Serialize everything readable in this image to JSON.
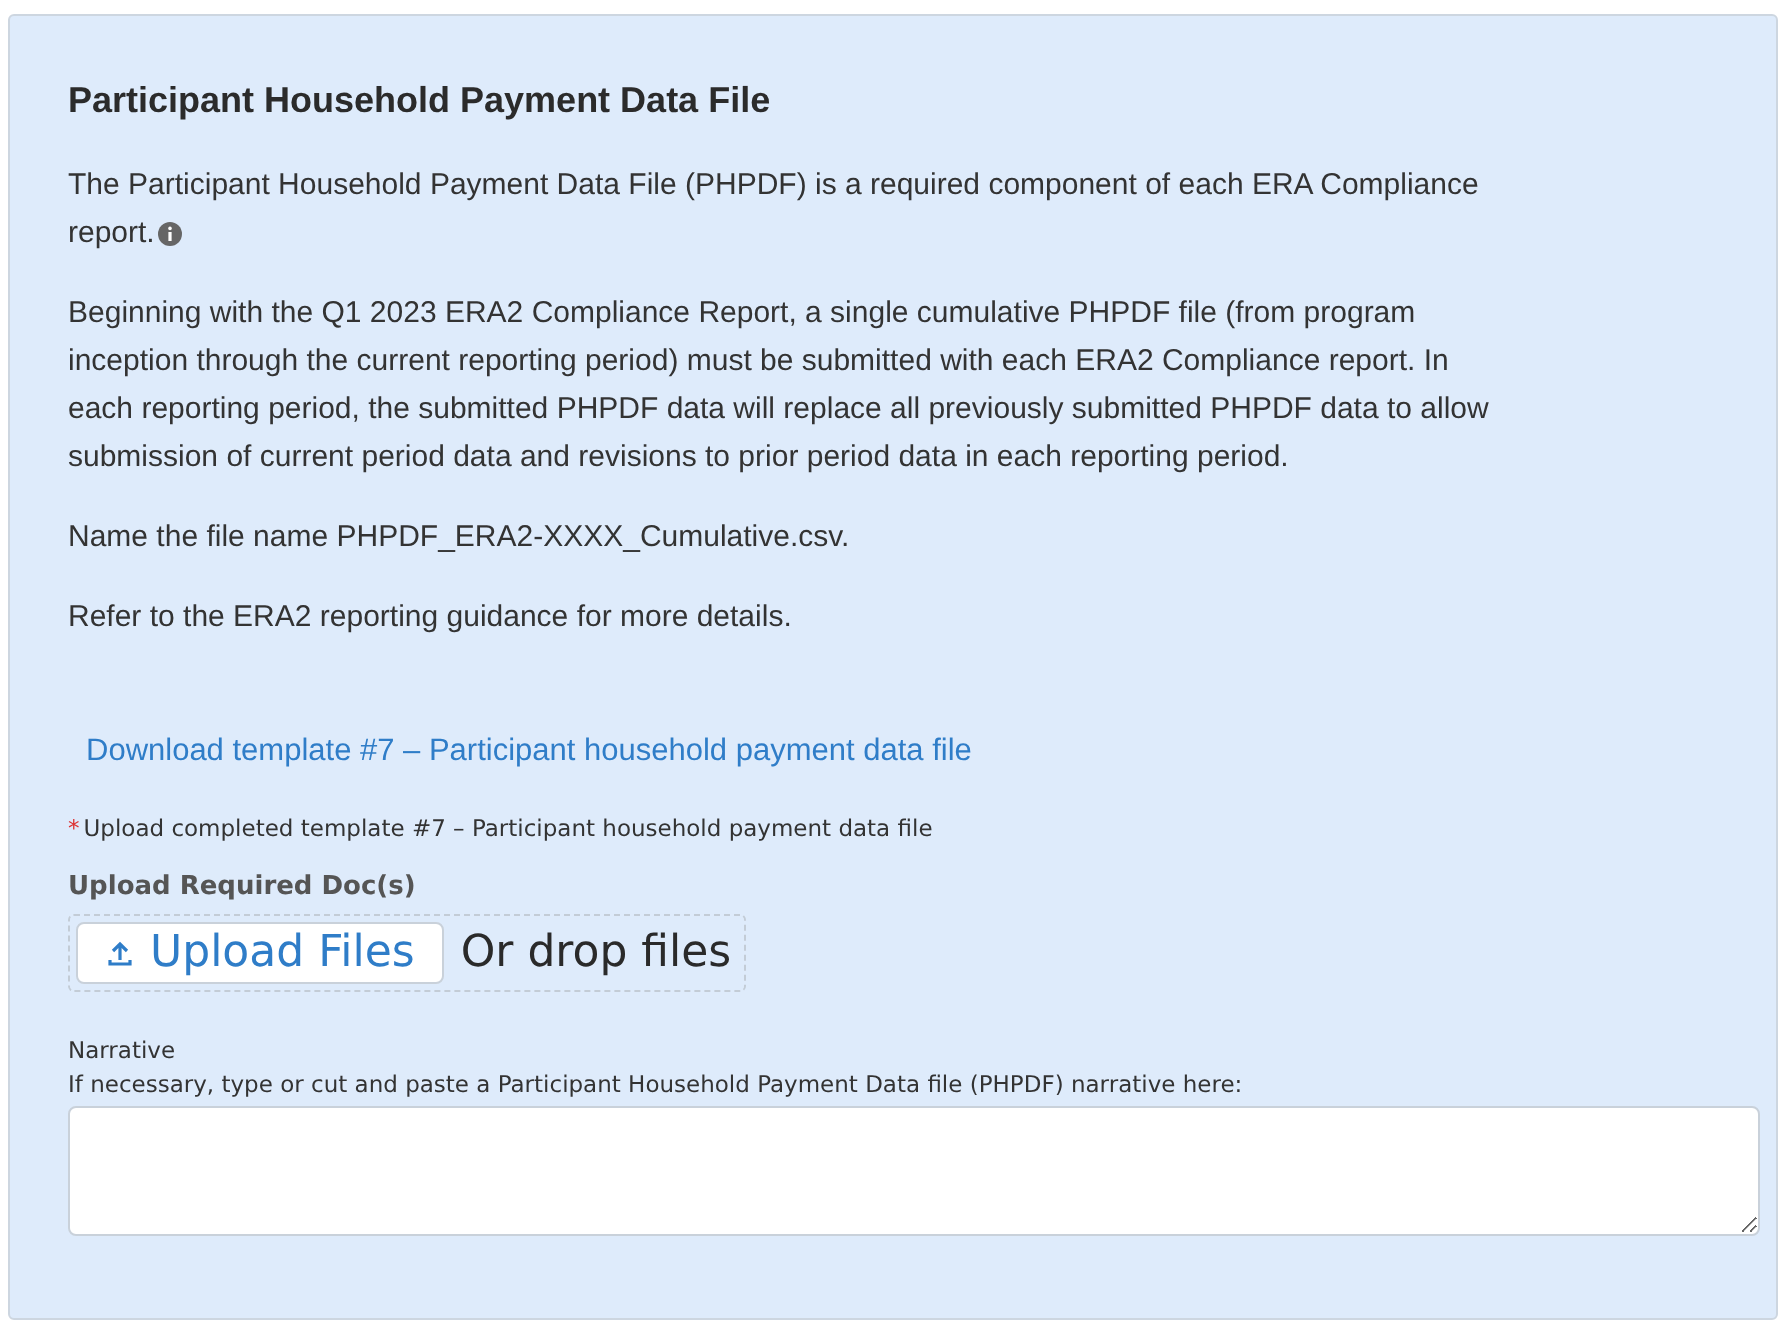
{
  "section": {
    "title": "Participant Household Payment Data File",
    "paragraphs": [
      {
        "text": "The Participant Household Payment Data File (PHPDF) is a required component of each ERA Compliance report.",
        "info_icon": true
      },
      {
        "text": "Beginning with the Q1 2023 ERA2 Compliance Report, a single cumulative PHPDF file (from program inception through the current reporting period) must be submitted with each ERA2 Compliance report. In each reporting period, the submitted PHPDF data will replace all previously submitted PHPDF data to allow submission of current period data and revisions to prior period data in each reporting period.",
        "info_icon": false
      },
      {
        "text": "Name the file name PHPDF_ERA2-XXXX_Cumulative.csv.",
        "info_icon": false
      },
      {
        "text": "Refer to the ERA2 reporting guidance for more details.",
        "info_icon": false
      }
    ],
    "download_link": "Download template #7 – Participant household payment data file",
    "upload": {
      "required_mark": "*",
      "instruction": "Upload completed template #7 – Participant household payment data file",
      "label": "Upload Required Doc(s)",
      "button": "Upload Files",
      "drop_text": "Or drop files"
    },
    "narrative": {
      "label": "Narrative",
      "help": "If necessary, type or cut and paste a Participant Household Payment Data file (PHPDF) narrative here:"
    }
  }
}
